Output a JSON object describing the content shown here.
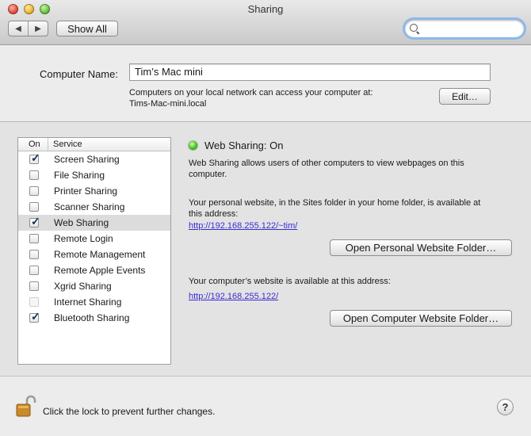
{
  "window": {
    "title": "Sharing"
  },
  "toolbar": {
    "back_glyph": "◀",
    "forward_glyph": "▶",
    "show_all": "Show All",
    "search": {
      "placeholder": ""
    }
  },
  "computer_name": {
    "label": "Computer Name:",
    "value": "Tim’s Mac mini",
    "desc_line1": "Computers on your local network can access your computer at:",
    "desc_line2": "Tims-Mac-mini.local",
    "edit_label": "Edit…"
  },
  "services": {
    "header_on": "On",
    "header_service": "Service",
    "items": [
      {
        "name": "Screen Sharing",
        "checked": true,
        "enabled": true,
        "selected": false
      },
      {
        "name": "File Sharing",
        "checked": false,
        "enabled": true,
        "selected": false
      },
      {
        "name": "Printer Sharing",
        "checked": false,
        "enabled": true,
        "selected": false
      },
      {
        "name": "Scanner Sharing",
        "checked": false,
        "enabled": true,
        "selected": false
      },
      {
        "name": "Web Sharing",
        "checked": true,
        "enabled": true,
        "selected": true
      },
      {
        "name": "Remote Login",
        "checked": false,
        "enabled": true,
        "selected": false
      },
      {
        "name": "Remote Management",
        "checked": false,
        "enabled": true,
        "selected": false
      },
      {
        "name": "Remote Apple Events",
        "checked": false,
        "enabled": true,
        "selected": false
      },
      {
        "name": "Xgrid Sharing",
        "checked": false,
        "enabled": true,
        "selected": false
      },
      {
        "name": "Internet Sharing",
        "checked": false,
        "enabled": false,
        "selected": false
      },
      {
        "name": "Bluetooth Sharing",
        "checked": true,
        "enabled": true,
        "selected": false
      }
    ]
  },
  "detail": {
    "status": "Web Sharing: On",
    "status_color": "#41c224",
    "desc_line1": "Web Sharing allows users of other computers to view webpages on this",
    "desc_line2": "computer.",
    "personal_line1": "Your personal website, in the Sites folder in your home folder, is available at",
    "personal_line2": "this address:",
    "personal_url": "http://192.168.255.122/~tim/",
    "open_personal": "Open Personal Website Folder…",
    "computer_line": "Your computer’s website is available at this address:",
    "computer_url": "http://192.168.255.122/",
    "open_computer": "Open Computer Website Folder…"
  },
  "footer": {
    "lock_text": "Click the lock to prevent further changes.",
    "help_glyph": "?"
  }
}
